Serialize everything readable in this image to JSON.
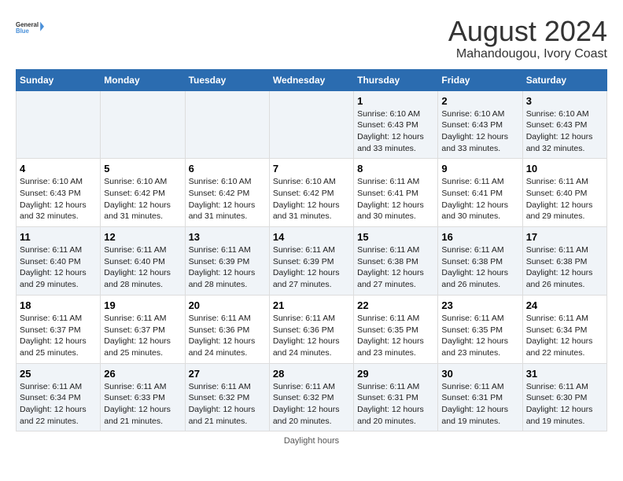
{
  "logo": {
    "line1": "General",
    "line2": "Blue"
  },
  "title": "August 2024",
  "subtitle": "Mahandougou, Ivory Coast",
  "days_of_week": [
    "Sunday",
    "Monday",
    "Tuesday",
    "Wednesday",
    "Thursday",
    "Friday",
    "Saturday"
  ],
  "weeks": [
    [
      {
        "day": "",
        "info": ""
      },
      {
        "day": "",
        "info": ""
      },
      {
        "day": "",
        "info": ""
      },
      {
        "day": "",
        "info": ""
      },
      {
        "day": "1",
        "info": "Sunrise: 6:10 AM\nSunset: 6:43 PM\nDaylight: 12 hours\nand 33 minutes."
      },
      {
        "day": "2",
        "info": "Sunrise: 6:10 AM\nSunset: 6:43 PM\nDaylight: 12 hours\nand 33 minutes."
      },
      {
        "day": "3",
        "info": "Sunrise: 6:10 AM\nSunset: 6:43 PM\nDaylight: 12 hours\nand 32 minutes."
      }
    ],
    [
      {
        "day": "4",
        "info": "Sunrise: 6:10 AM\nSunset: 6:43 PM\nDaylight: 12 hours\nand 32 minutes."
      },
      {
        "day": "5",
        "info": "Sunrise: 6:10 AM\nSunset: 6:42 PM\nDaylight: 12 hours\nand 31 minutes."
      },
      {
        "day": "6",
        "info": "Sunrise: 6:10 AM\nSunset: 6:42 PM\nDaylight: 12 hours\nand 31 minutes."
      },
      {
        "day": "7",
        "info": "Sunrise: 6:10 AM\nSunset: 6:42 PM\nDaylight: 12 hours\nand 31 minutes."
      },
      {
        "day": "8",
        "info": "Sunrise: 6:11 AM\nSunset: 6:41 PM\nDaylight: 12 hours\nand 30 minutes."
      },
      {
        "day": "9",
        "info": "Sunrise: 6:11 AM\nSunset: 6:41 PM\nDaylight: 12 hours\nand 30 minutes."
      },
      {
        "day": "10",
        "info": "Sunrise: 6:11 AM\nSunset: 6:40 PM\nDaylight: 12 hours\nand 29 minutes."
      }
    ],
    [
      {
        "day": "11",
        "info": "Sunrise: 6:11 AM\nSunset: 6:40 PM\nDaylight: 12 hours\nand 29 minutes."
      },
      {
        "day": "12",
        "info": "Sunrise: 6:11 AM\nSunset: 6:40 PM\nDaylight: 12 hours\nand 28 minutes."
      },
      {
        "day": "13",
        "info": "Sunrise: 6:11 AM\nSunset: 6:39 PM\nDaylight: 12 hours\nand 28 minutes."
      },
      {
        "day": "14",
        "info": "Sunrise: 6:11 AM\nSunset: 6:39 PM\nDaylight: 12 hours\nand 27 minutes."
      },
      {
        "day": "15",
        "info": "Sunrise: 6:11 AM\nSunset: 6:38 PM\nDaylight: 12 hours\nand 27 minutes."
      },
      {
        "day": "16",
        "info": "Sunrise: 6:11 AM\nSunset: 6:38 PM\nDaylight: 12 hours\nand 26 minutes."
      },
      {
        "day": "17",
        "info": "Sunrise: 6:11 AM\nSunset: 6:38 PM\nDaylight: 12 hours\nand 26 minutes."
      }
    ],
    [
      {
        "day": "18",
        "info": "Sunrise: 6:11 AM\nSunset: 6:37 PM\nDaylight: 12 hours\nand 25 minutes."
      },
      {
        "day": "19",
        "info": "Sunrise: 6:11 AM\nSunset: 6:37 PM\nDaylight: 12 hours\nand 25 minutes."
      },
      {
        "day": "20",
        "info": "Sunrise: 6:11 AM\nSunset: 6:36 PM\nDaylight: 12 hours\nand 24 minutes."
      },
      {
        "day": "21",
        "info": "Sunrise: 6:11 AM\nSunset: 6:36 PM\nDaylight: 12 hours\nand 24 minutes."
      },
      {
        "day": "22",
        "info": "Sunrise: 6:11 AM\nSunset: 6:35 PM\nDaylight: 12 hours\nand 23 minutes."
      },
      {
        "day": "23",
        "info": "Sunrise: 6:11 AM\nSunset: 6:35 PM\nDaylight: 12 hours\nand 23 minutes."
      },
      {
        "day": "24",
        "info": "Sunrise: 6:11 AM\nSunset: 6:34 PM\nDaylight: 12 hours\nand 22 minutes."
      }
    ],
    [
      {
        "day": "25",
        "info": "Sunrise: 6:11 AM\nSunset: 6:34 PM\nDaylight: 12 hours\nand 22 minutes."
      },
      {
        "day": "26",
        "info": "Sunrise: 6:11 AM\nSunset: 6:33 PM\nDaylight: 12 hours\nand 21 minutes."
      },
      {
        "day": "27",
        "info": "Sunrise: 6:11 AM\nSunset: 6:32 PM\nDaylight: 12 hours\nand 21 minutes."
      },
      {
        "day": "28",
        "info": "Sunrise: 6:11 AM\nSunset: 6:32 PM\nDaylight: 12 hours\nand 20 minutes."
      },
      {
        "day": "29",
        "info": "Sunrise: 6:11 AM\nSunset: 6:31 PM\nDaylight: 12 hours\nand 20 minutes."
      },
      {
        "day": "30",
        "info": "Sunrise: 6:11 AM\nSunset: 6:31 PM\nDaylight: 12 hours\nand 19 minutes."
      },
      {
        "day": "31",
        "info": "Sunrise: 6:11 AM\nSunset: 6:30 PM\nDaylight: 12 hours\nand 19 minutes."
      }
    ]
  ],
  "footer": "Daylight hours"
}
